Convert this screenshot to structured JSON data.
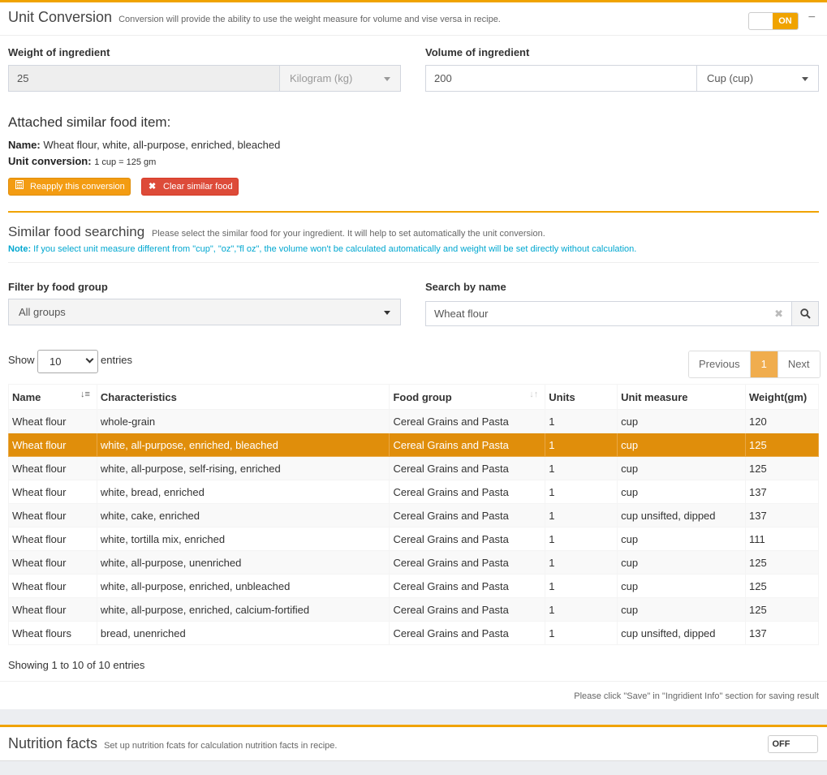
{
  "unit_conversion": {
    "title": "Unit Conversion",
    "subtitle": "Conversion will provide the ability to use the weight measure for volume and vise versa in recipe.",
    "toggle_label": "ON",
    "collapse_symbol": "−",
    "weight_label": "Weight of ingredient",
    "weight_value": "25",
    "weight_unit": "Kilogram (kg)",
    "volume_label": "Volume of ingredient",
    "volume_value": "200",
    "volume_unit": "Cup (cup)"
  },
  "attached": {
    "heading": "Attached similar food item:",
    "name_label": "Name:",
    "name_value": "Wheat flour, white, all-purpose, enriched, bleached",
    "conversion_label": "Unit conversion:",
    "conversion_value": "1 cup = 125 gm",
    "reapply_label": "Reapply this conversion",
    "clear_label": "Clear similar food"
  },
  "similar": {
    "title": "Similar food searching",
    "subtitle": "Please select the similar food for your ingredient. It will help to set automatically the unit conversion.",
    "note_label": "Note:",
    "note_text": "If you select unit measure different from \"cup\", \"oz\",\"fl oz\", the volume won't be calculated automatically and weight will be set directly without calculation.",
    "filter_label": "Filter by food group",
    "filter_value": "All groups",
    "search_label": "Search by name",
    "search_value": "Wheat flour",
    "show_label": "Show",
    "page_length": "10",
    "entries_label": "entries",
    "pager": {
      "previous": "Previous",
      "current": "1",
      "next": "Next"
    },
    "info": "Showing 1 to 10 of 10 entries",
    "footer_note": "Please click \"Save\" in \"Ingridient Info\" section for saving result"
  },
  "table": {
    "columns": [
      "Name",
      "Characteristics",
      "Food group",
      "Units",
      "Unit measure",
      "Weight(gm)"
    ],
    "selected_row": 1,
    "rows": [
      [
        "Wheat flour",
        "whole-grain",
        "Cereal Grains and Pasta",
        "1",
        "cup",
        "120"
      ],
      [
        "Wheat flour",
        "white, all-purpose, enriched, bleached",
        "Cereal Grains and Pasta",
        "1",
        "cup",
        "125"
      ],
      [
        "Wheat flour",
        "white, all-purpose, self-rising, enriched",
        "Cereal Grains and Pasta",
        "1",
        "cup",
        "125"
      ],
      [
        "Wheat flour",
        "white, bread, enriched",
        "Cereal Grains and Pasta",
        "1",
        "cup",
        "137"
      ],
      [
        "Wheat flour",
        "white, cake, enriched",
        "Cereal Grains and Pasta",
        "1",
        "cup unsifted, dipped",
        "137"
      ],
      [
        "Wheat flour",
        "white, tortilla mix, enriched",
        "Cereal Grains and Pasta",
        "1",
        "cup",
        "111"
      ],
      [
        "Wheat flour",
        "white, all-purpose, unenriched",
        "Cereal Grains and Pasta",
        "1",
        "cup",
        "125"
      ],
      [
        "Wheat flour",
        "white, all-purpose, enriched, unbleached",
        "Cereal Grains and Pasta",
        "1",
        "cup",
        "125"
      ],
      [
        "Wheat flour",
        "white, all-purpose, enriched, calcium-fortified",
        "Cereal Grains and Pasta",
        "1",
        "cup",
        "125"
      ],
      [
        "Wheat flours",
        "bread, unenriched",
        "Cereal Grains and Pasta",
        "1",
        "cup unsifted, dipped",
        "137"
      ]
    ]
  },
  "nutrition": {
    "title": "Nutrition facts",
    "subtitle": "Set up nutrition fcats for calculation nutrition facts in recipe.",
    "toggle_label": "OFF"
  },
  "colors": {
    "accent": "#f0a300",
    "selected_row": "#e08e0b",
    "danger": "#dd4b39",
    "note": "#00a7d0"
  },
  "icons": {
    "reapply": "calculator-icon",
    "clear": "times-icon",
    "search": "search-icon",
    "sort": "sort-icon"
  }
}
